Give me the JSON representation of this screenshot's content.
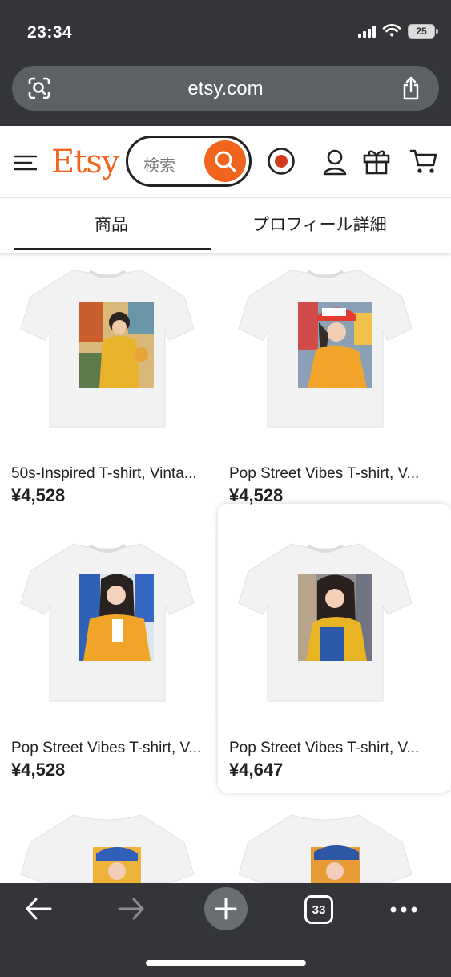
{
  "status": {
    "time": "23:34",
    "battery": "25"
  },
  "browser": {
    "url": "etsy.com",
    "tabs_count": "33"
  },
  "header": {
    "logo": "Etsy",
    "search_placeholder": "検索"
  },
  "tabs": [
    {
      "label": "商品",
      "active": true
    },
    {
      "label": "プロフィール詳細",
      "active": false
    }
  ],
  "products": [
    {
      "title": "50s-Inspired T-shirt, Vinta...",
      "price": "¥4,528"
    },
    {
      "title": "Pop Street Vibes T-shirt, V...",
      "price": "¥4,528"
    },
    {
      "title": "Pop Street Vibes T-shirt, V...",
      "price": "¥4,528"
    },
    {
      "title": "Pop Street Vibes T-shirt, V...",
      "price": "¥4,647"
    }
  ],
  "colors": {
    "brand": "#f1641e",
    "chrome": "#333538"
  }
}
